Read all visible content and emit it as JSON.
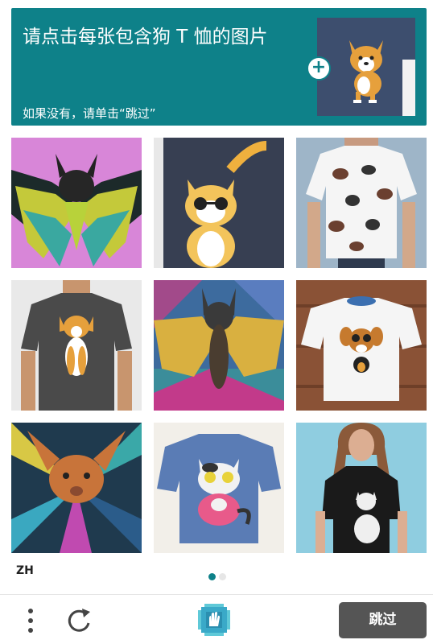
{
  "header": {
    "title": "请点击每张包含狗 T 恤的图片",
    "subtitle": "如果没有，请单击“跳过”",
    "background_color": "#0e8189",
    "sample_icon": "dog-shirt-sample",
    "add_icon": "plus-icon"
  },
  "grid": {
    "tiles": [
      {
        "name": "tile-bat-painting-pink"
      },
      {
        "name": "tile-cat-sunglasses-shirt"
      },
      {
        "name": "tile-person-pattern-shirt"
      },
      {
        "name": "tile-man-dog-shirt"
      },
      {
        "name": "tile-bat-painting-colorful"
      },
      {
        "name": "tile-dog-shirt-wood"
      },
      {
        "name": "tile-cat-painting-rays"
      },
      {
        "name": "tile-cat-blue-shirt"
      },
      {
        "name": "tile-woman-cat-shirt"
      }
    ]
  },
  "footer": {
    "language": "ZH",
    "skip_label": "跳过",
    "pagination": {
      "count": 2,
      "active": 0
    },
    "accent_color": "#0e8189",
    "button_color": "#555555"
  }
}
